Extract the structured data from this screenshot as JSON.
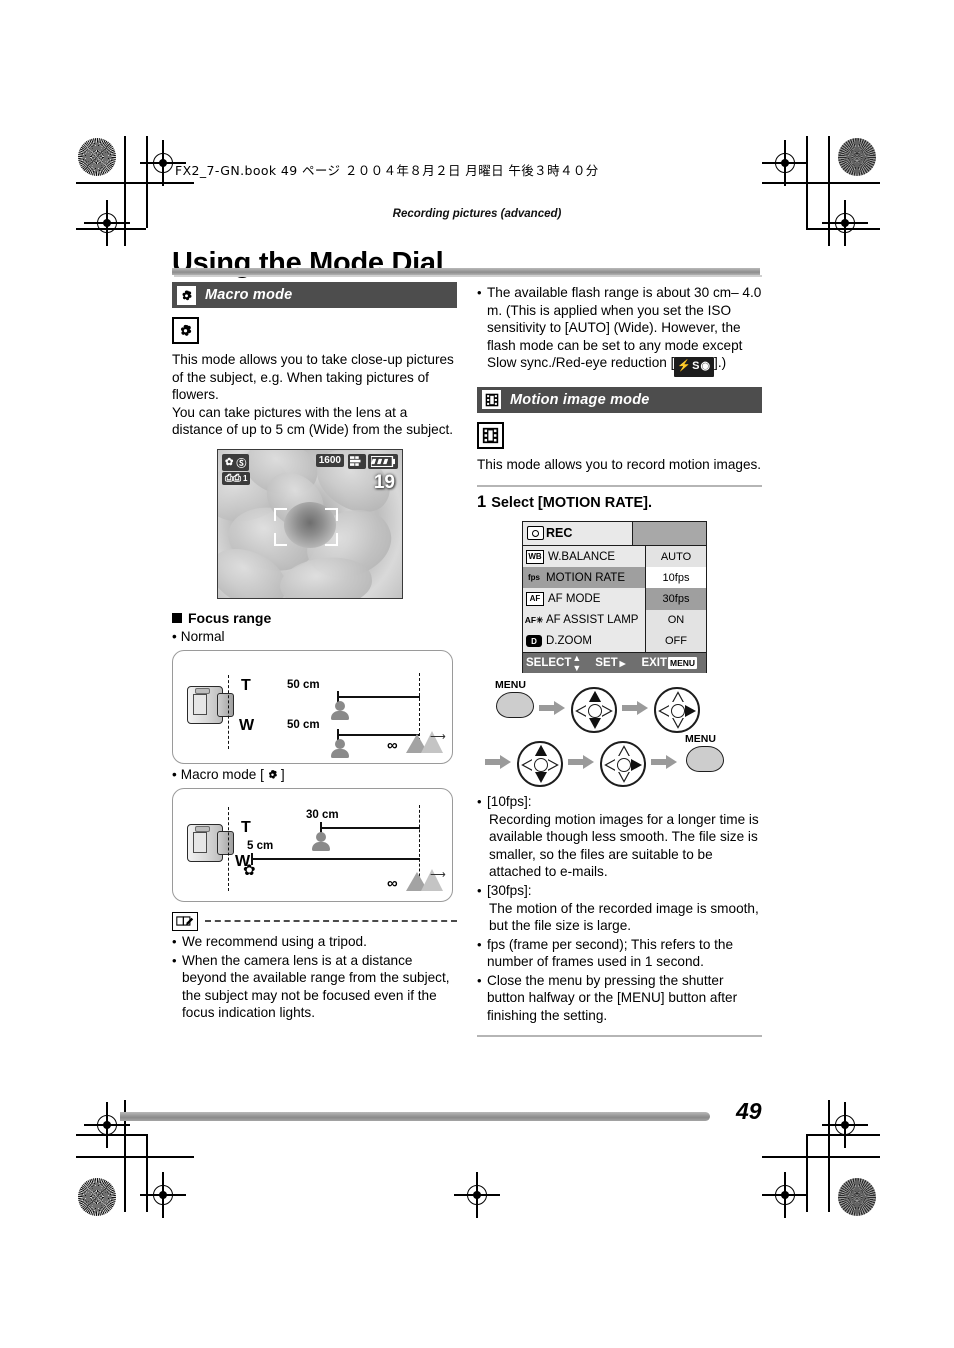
{
  "print_header": {
    "book_line": "FX2_7-GN.book   49 ページ   ２００４年８月２日   月曜日   午後３時４０分"
  },
  "running_head": "Recording pictures (advanced)",
  "page_title": "Using the Mode Dial",
  "page_number": "49",
  "left_column": {
    "section": {
      "icon": "macro-flower-icon",
      "title": "Macro mode"
    },
    "mode_icon": "macro-flower-icon",
    "body": "This mode allows you to take close-up pictures of the subject, e.g. When taking pictures of flowers.\nYou can take pictures with the lens at a distance of up to 5 cm (Wide) from the subject.",
    "body_line1": "This mode allows you to take close-up pictures of the subject, e.g. When taking pictures of flowers.",
    "body_line2": "You can take pictures with the lens at a distance of up to 5 cm (Wide) from the subject.",
    "lcd_preview": {
      "iso_value": "1600",
      "frames_remaining": "19",
      "stabilizer_mode": "1",
      "icons": [
        "macro-flower-icon",
        "flash-off-icon",
        "stabilizer-icon",
        "picture-quality-icon",
        "battery-icon"
      ]
    },
    "focus_range_heading": "Focus range",
    "normal_label": "Normal",
    "normal_diagram": {
      "tele_label": "T",
      "tele_distance": "50 cm",
      "wide_label": "W",
      "wide_distance": "50 cm",
      "infinity": "∞"
    },
    "macro_label": "Macro mode [",
    "macro_label_end": "]",
    "macro_diagram": {
      "tele_label": "T",
      "tele_distance": "30 cm",
      "wide_label": "W",
      "wide_distance": "5 cm",
      "infinity": "∞"
    },
    "notes": [
      "We recommend using a tripod.",
      "When the camera lens is at a distance beyond the available range from the subject, the subject may not be focused even if the focus indication lights."
    ]
  },
  "right_column": {
    "flash_note": "The available flash range is about 30 cm– 4.0 m. (This is applied when you set the ISO sensitivity to [AUTO] (Wide). However, the flash mode can be set to any mode except Slow sync./Red-eye reduction [",
    "flash_note_end": "].)",
    "flash_chip_label": "S",
    "section": {
      "icon": "motion-film-icon",
      "title": "Motion image mode"
    },
    "mode_icon": "motion-film-icon",
    "body": "This mode allows you to record motion images.",
    "step": {
      "number": "1",
      "text": "Select [MOTION RATE]."
    },
    "menu": {
      "tab_label": "REC",
      "rows": [
        {
          "icon": "WB",
          "label": "W.BALANCE",
          "value": "AUTO",
          "state": "normal"
        },
        {
          "icon": "fps",
          "label": "MOTION RATE",
          "value": "10fps",
          "state": "selected-row"
        },
        {
          "icon": "AF",
          "label": "AF MODE",
          "value": "30fps",
          "state": "selected-value"
        },
        {
          "icon": "AF✳",
          "label": "AF ASSIST LAMP",
          "value": "ON",
          "state": "normal"
        },
        {
          "icon": "D",
          "label": "D.ZOOM",
          "value": "OFF",
          "state": "normal"
        }
      ],
      "footer": {
        "select": "SELECT",
        "set": "SET",
        "exit": "EXIT",
        "menu_badge": "MENU"
      }
    },
    "button_flow": {
      "first_button": "MENU",
      "last_button": "MENU",
      "steps": [
        "menu-button",
        "updown-dpad",
        "right-dpad",
        "updown-dpad",
        "right-dpad",
        "menu-button"
      ]
    },
    "notes": [
      {
        "term": "[10fps]:",
        "text": "Recording motion images for a longer time is available though less smooth. The file size is smaller, so the files are suitable to be attached to e-mails."
      },
      {
        "term": "[30fps]:",
        "text": "The motion of the recorded image is smooth, but the file size is large."
      },
      {
        "term": "",
        "text": "fps (frame per second); This refers to the number of frames used in 1 second."
      },
      {
        "term": "",
        "text": "Close the menu by pressing the shutter button halfway or the [MENU] button after finishing the setting."
      }
    ]
  },
  "colors": {
    "section_bar": "#4d4d4d",
    "rule": "#b5b5b5",
    "menu_selected": "#9f9f9f",
    "menu_bg": "#e9e9e9"
  }
}
